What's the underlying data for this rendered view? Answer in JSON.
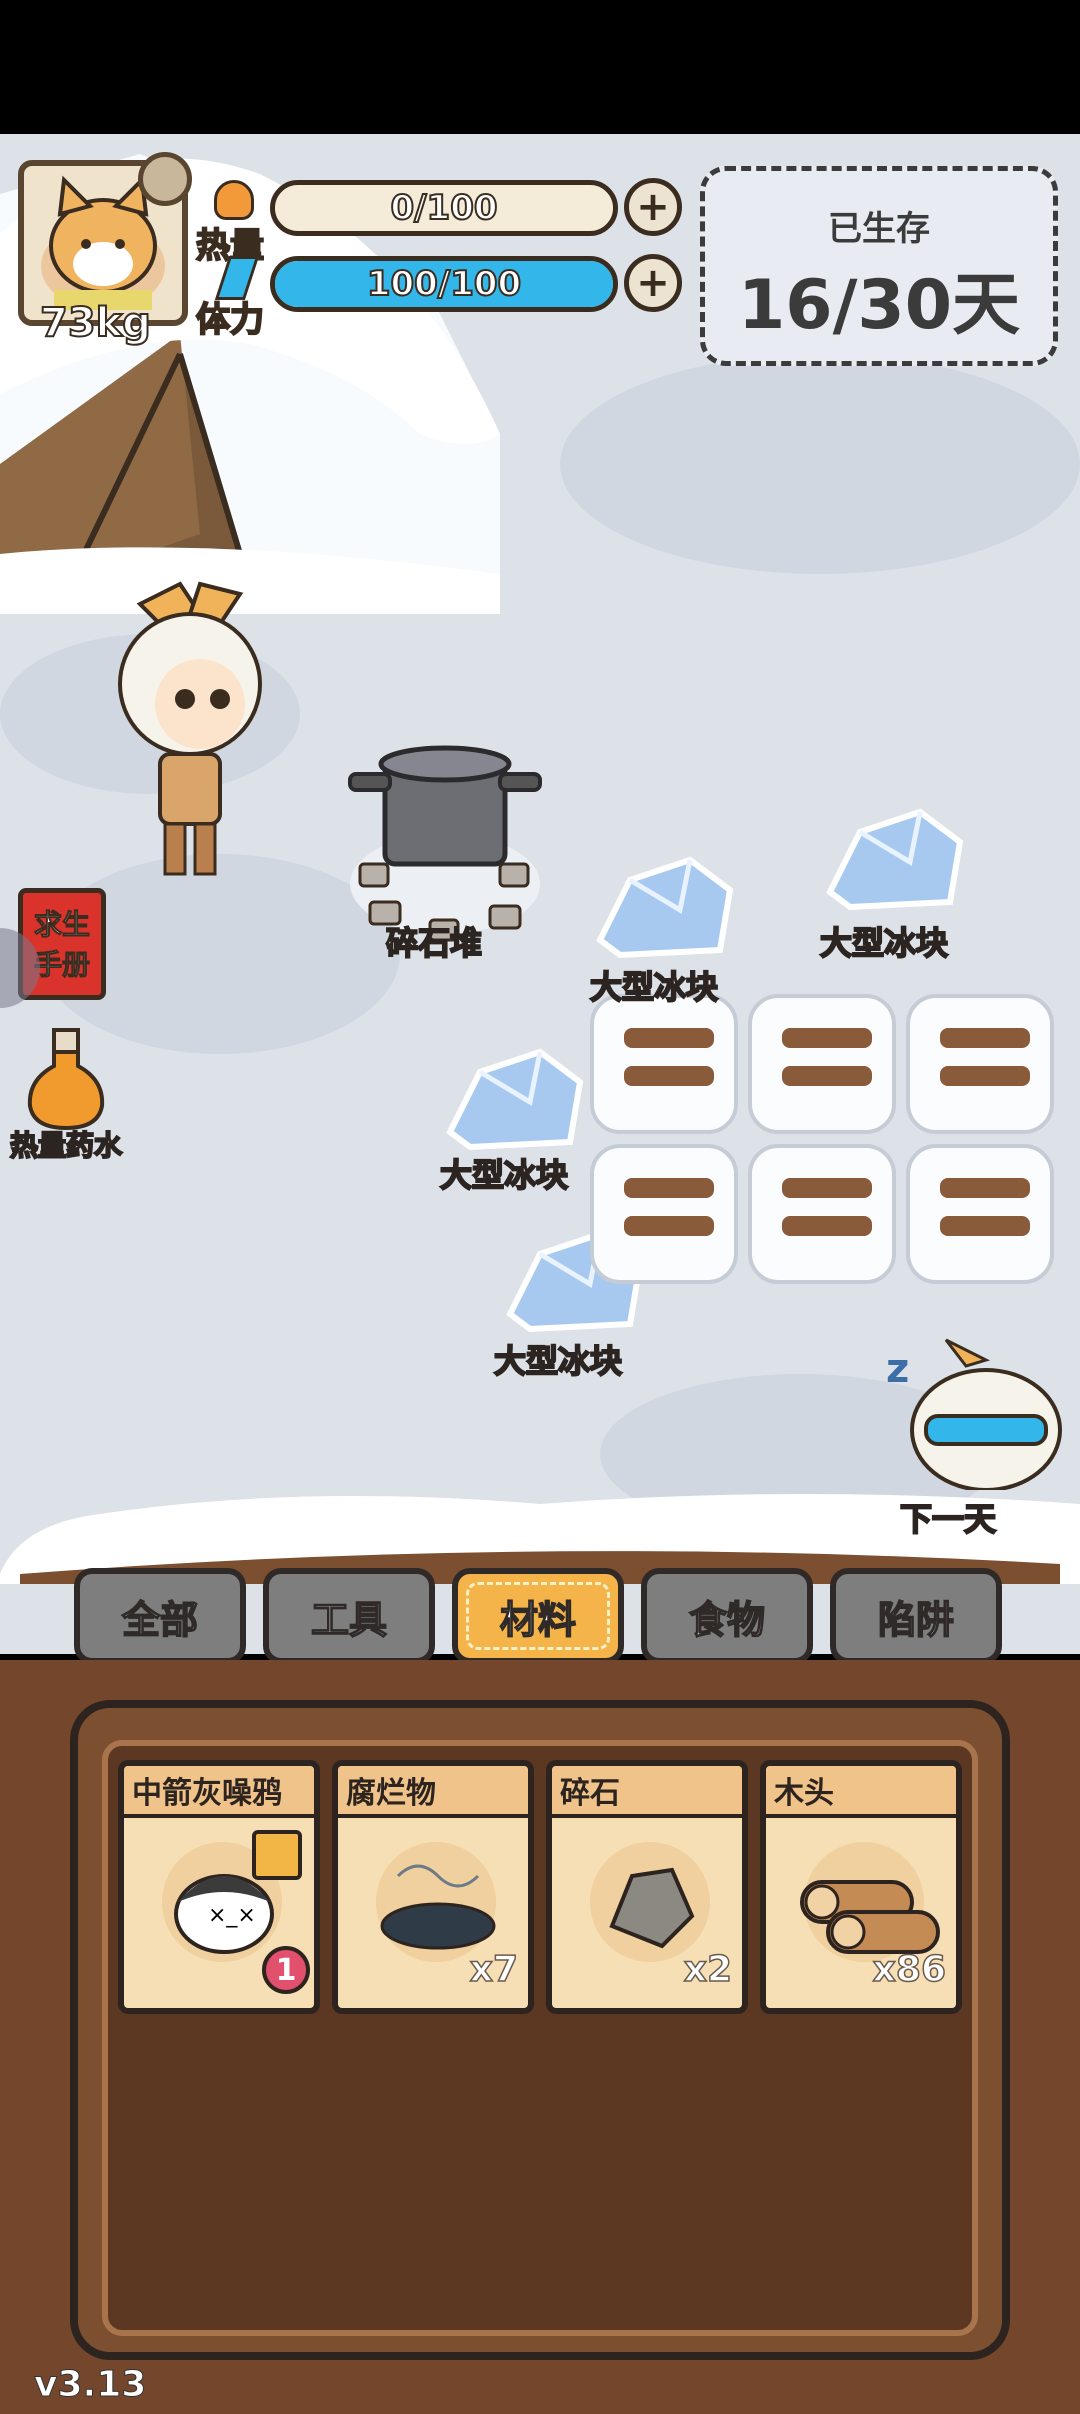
{
  "hud": {
    "weight": "73kg",
    "heat": {
      "label": "热量",
      "value": "0/100",
      "fraction": 0
    },
    "stamina": {
      "label": "体力",
      "value": "100/100",
      "fraction": 1
    },
    "survival": {
      "title": "已生存",
      "days": "16/30天"
    }
  },
  "scene": {
    "rubble_label": "碎石堆",
    "ice_labels": [
      "大型冰块",
      "大型冰块",
      "大型冰块",
      "大型冰块"
    ],
    "manual_label_line1": "求生",
    "manual_label_line2": "手册",
    "potion_label": "热量药水",
    "next_day_label": "下一天"
  },
  "tabs": [
    {
      "label": "全部",
      "active": false
    },
    {
      "label": "工具",
      "active": false
    },
    {
      "label": "材料",
      "active": true
    },
    {
      "label": "食物",
      "active": false
    },
    {
      "label": "陷阱",
      "active": false
    }
  ],
  "inventory": [
    {
      "name": "中箭灰噪鸦",
      "count": "",
      "badge": "1"
    },
    {
      "name": "腐烂物",
      "count": "x7",
      "badge": ""
    },
    {
      "name": "碎石",
      "count": "x2",
      "badge": ""
    },
    {
      "name": "木头",
      "count": "x86",
      "badge": ""
    }
  ],
  "version": "v3.13",
  "colors": {
    "stamina_bar": "#33b7ea",
    "active_tab": "#f4b449",
    "inactive_tab": "#7e7e7e",
    "card_bg": "#f6dfb4",
    "inventory_bg": "#5c3822"
  }
}
